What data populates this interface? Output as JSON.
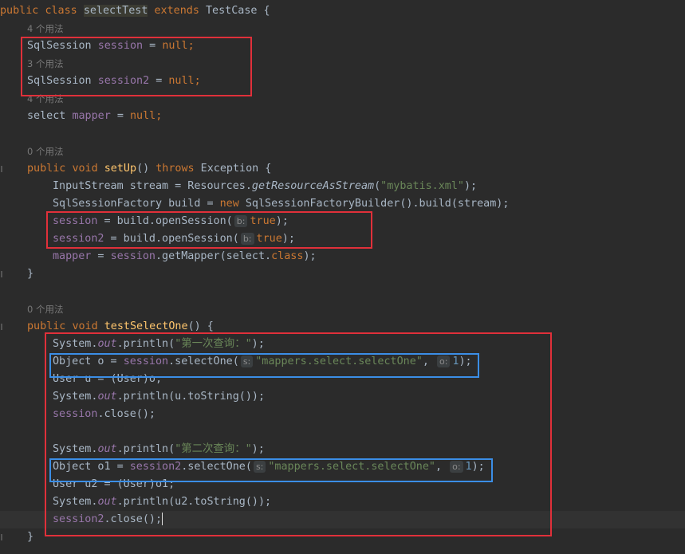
{
  "code": {
    "l1": {
      "public": "public",
      "class": "class",
      "name": "selectTest",
      "extends": "extends",
      "base": "TestCase",
      "brace": " {"
    },
    "hint1": "4 个用法",
    "l2": {
      "type": "SqlSession",
      "var": "session",
      "eq": " = ",
      "val": "null",
      "semi": ";"
    },
    "hint2": "3 个用法",
    "l3": {
      "type": "SqlSession",
      "var": "session2",
      "eq": " = ",
      "val": "null",
      "semi": ";"
    },
    "hint3": "4 个用法",
    "l4": {
      "type": "select",
      "var": "mapper",
      "eq": " = ",
      "val": "null",
      "semi": ";"
    },
    "hint4": "0 个用法",
    "l5": {
      "public": "public",
      "void": "void",
      "name": "setUp",
      "paren": "() ",
      "throws": "throws",
      "exc": " Exception {"
    },
    "l6": {
      "a": "InputStream stream = Resources.",
      "method": "getResourceAsStream",
      "b": "(",
      "str": "\"mybatis.xml\"",
      "c": ");"
    },
    "l7": {
      "a": "SqlSessionFactory build = ",
      "new": "new",
      "b": " SqlSessionFactoryBuilder().build(stream);"
    },
    "l8": {
      "var": "session",
      "a": " = build.openSession(",
      "hint": "b:",
      "val": "true",
      "b": ");"
    },
    "l9": {
      "var": "session2",
      "a": " = build.openSession(",
      "hint": "b:",
      "val": "true",
      "b": ");"
    },
    "l10": {
      "var": "mapper",
      "a": " = ",
      "var2": "session",
      "b": ".getMapper(select.",
      "cls": "class",
      "c": ");"
    },
    "l11": "}",
    "hint5": "0 个用法",
    "l12": {
      "public": "public",
      "void": "void",
      "name": "testSelectOne",
      "rest": "() {"
    },
    "l13": {
      "a": "System.",
      "out": "out",
      "b": ".println(",
      "str": "\"第一次查询：\"",
      "c": ");"
    },
    "l14": {
      "a": "Object o = ",
      "var": "session",
      "b": ".selectOne(",
      "hint1": "s:",
      "str": "\"mappers.select.selectOne\"",
      "comma": ", ",
      "hint2": "o:",
      "num": "1",
      "c": ");"
    },
    "l15": "User u = (User)o;",
    "l16": {
      "a": "System.",
      "out": "out",
      "b": ".println(u.toString());"
    },
    "l17": {
      "var": "session",
      "b": ".close();"
    },
    "l18": {
      "a": "System.",
      "out": "out",
      "b": ".println(",
      "str": "\"第二次查询：\"",
      "c": ");"
    },
    "l19": {
      "a": "Object o1 = ",
      "var": "session2",
      "b": ".selectOne(",
      "hint1": "s:",
      "str": "\"mappers.select.selectOne\"",
      "comma": ", ",
      "hint2": "o:",
      "num": "1",
      "c": ");"
    },
    "l20": "User u2 = (User)o1;",
    "l21": {
      "a": "System.",
      "out": "out",
      "b": ".println(u2.toString());"
    },
    "l22": {
      "var": "session2",
      "b": ".close();"
    },
    "l23": "}"
  },
  "colors": {
    "background": "#2b2b2b",
    "keyword": "#cc7832",
    "field": "#9876aa",
    "method": "#ffc66d",
    "string": "#6a8759",
    "number": "#6897bb",
    "red_box": "#e0303a",
    "blue_box": "#3b8ee6"
  }
}
